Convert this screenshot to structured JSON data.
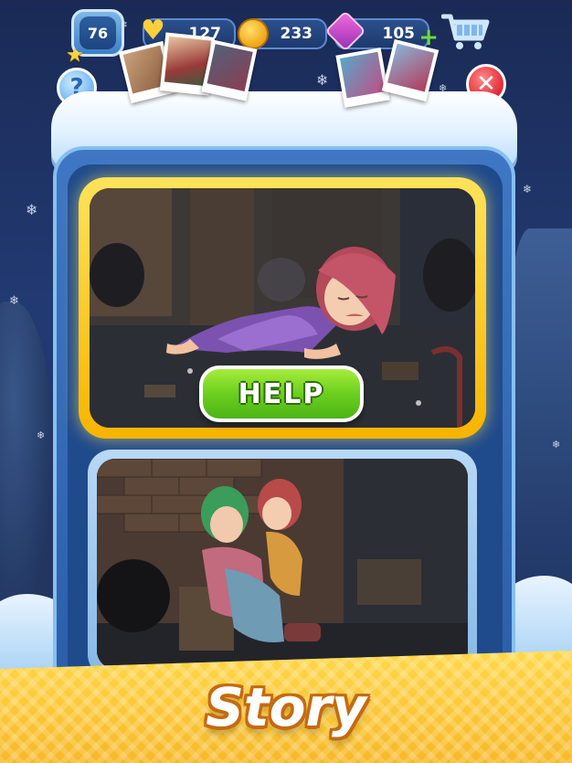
{
  "hud": {
    "level": "76",
    "lives": "127",
    "coins": "233",
    "gems": "105"
  },
  "icons": {
    "star": "star-icon",
    "heart": "heart-icon",
    "coin": "coin-icon",
    "gem": "gem-icon",
    "plus": "plus-icon",
    "cart": "cart-icon",
    "help": "question-icon",
    "close": "close-icon"
  },
  "buttons": {
    "help_glyph": "?",
    "close_glyph": "✕",
    "help_action": "HELP"
  },
  "title": "Story",
  "colors": {
    "help_button": "#6ccf1f",
    "close_button": "#e02835",
    "banner": "#f7b826",
    "active_frame": "#ffd21e"
  }
}
